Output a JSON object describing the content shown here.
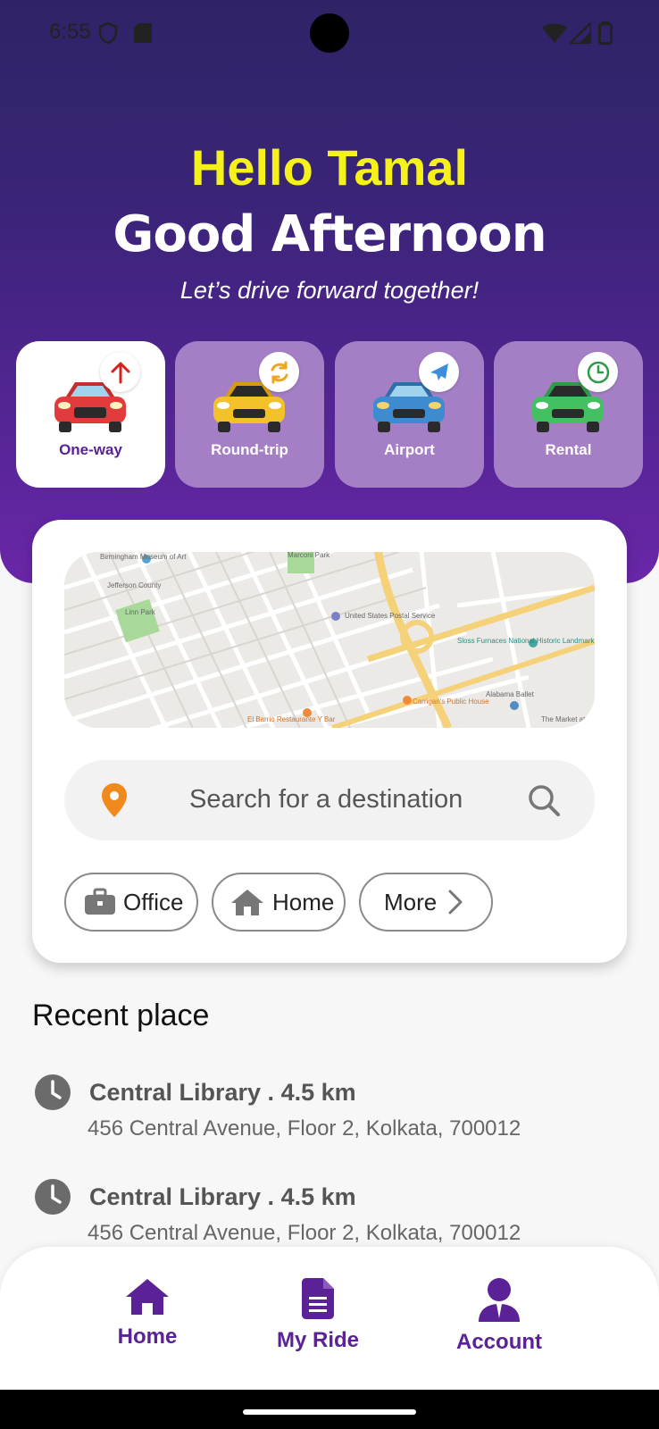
{
  "status_bar": {
    "time": "6:55"
  },
  "header": {
    "greeting": "Hello Tamal",
    "salutation": "Good Afternoon",
    "tagline": "Let’s drive forward together!"
  },
  "trip_types": [
    {
      "label": "One-way",
      "icon": "arrow-up-icon",
      "selected": true
    },
    {
      "label": "Round-trip",
      "icon": "refresh-icon",
      "selected": false
    },
    {
      "label": "Airport",
      "icon": "airplane-icon",
      "selected": false
    },
    {
      "label": "Rental",
      "icon": "clock-icon",
      "selected": false
    }
  ],
  "map": {
    "labels": [
      "Birmingham Museum of Art",
      "Marconi Park",
      "Jefferson County",
      "Linn Park",
      "United States Postal Service",
      "Sloss Furnaces National Historic Landmark",
      "Carrigan's Public House",
      "Alabama Ballet",
      "El Barrio Restaurante Y Bar",
      "The Market at"
    ]
  },
  "search": {
    "placeholder": "Search for a destination"
  },
  "quick_places": [
    {
      "label": "Office",
      "icon": "briefcase-icon"
    },
    {
      "label": "Home",
      "icon": "home-icon"
    },
    {
      "label": "More",
      "icon": "chevron-right-icon"
    }
  ],
  "recent": {
    "title": "Recent place",
    "items": [
      {
        "name": "Central Library . 4.5 km",
        "address": "456 Central Avenue, Floor 2, Kolkata, 700012"
      },
      {
        "name": "Central Library . 4.5 km",
        "address": "456 Central Avenue, Floor 2, Kolkata, 700012"
      }
    ]
  },
  "bottom_nav": [
    {
      "label": "Home",
      "icon": "home-icon"
    },
    {
      "label": "My Ride",
      "icon": "document-icon"
    },
    {
      "label": "Account",
      "icon": "user-icon"
    }
  ],
  "colors": {
    "accent": "#5a2296",
    "greeting": "#f4f21a",
    "hero_top": "#2f2366",
    "hero_bottom": "#6a27a8"
  }
}
